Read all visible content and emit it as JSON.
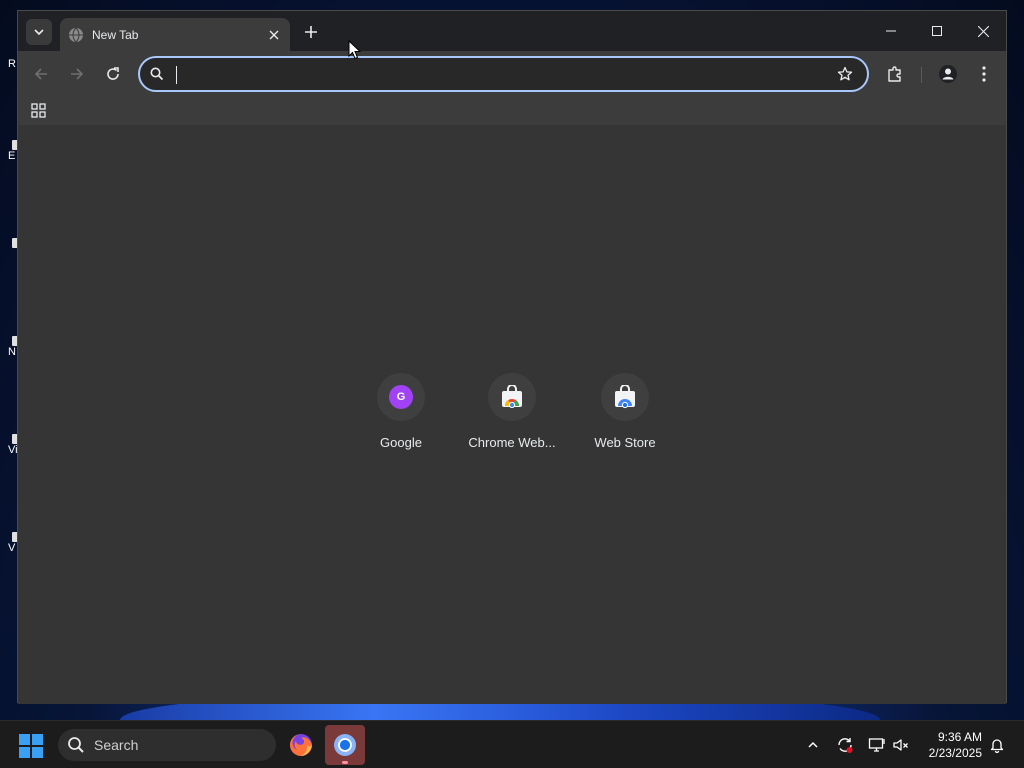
{
  "desktop": {
    "icons": [
      {
        "label": "R"
      },
      {
        "label": "E"
      },
      {
        "label": ""
      },
      {
        "label": "N"
      },
      {
        "label": "Vis"
      },
      {
        "label": "V"
      }
    ]
  },
  "browser": {
    "tab": {
      "title": "New Tab"
    },
    "omnibox": {
      "value": "",
      "placeholder": ""
    },
    "shortcuts": [
      {
        "label": "Google",
        "icon": "google-avatar-icon",
        "avatar_letter": "G"
      },
      {
        "label": "Chrome Web...",
        "icon": "chrome-web-store-icon"
      },
      {
        "label": "Web Store",
        "icon": "web-store-icon"
      }
    ],
    "colors": {
      "accent": "#a8c7fa",
      "tab_bg": "#3c3c3c",
      "titlebar": "#202124",
      "content_bg": "#353535"
    }
  },
  "taskbar": {
    "search_label": "Search",
    "apps": [
      {
        "name": "firefox-icon"
      },
      {
        "name": "chrome-icon",
        "active": true
      }
    ],
    "clock": {
      "time": "9:36 AM",
      "date": "2/23/2025"
    }
  }
}
